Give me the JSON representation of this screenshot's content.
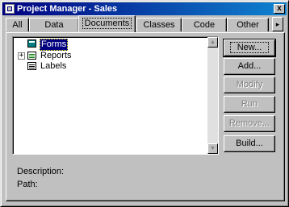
{
  "window": {
    "title": "Project Manager - Sales",
    "close_label": "x"
  },
  "tabs": [
    {
      "label": "All",
      "active": false
    },
    {
      "label": "Data",
      "active": false
    },
    {
      "label": "Documents",
      "active": true
    },
    {
      "label": "Classes",
      "active": false
    },
    {
      "label": "Code",
      "active": false
    },
    {
      "label": "Other",
      "active": false
    }
  ],
  "tab_scroll_label": "▸",
  "tree": {
    "items": [
      {
        "label": "Forms",
        "icon": "form-icon",
        "selected": true,
        "expander": ""
      },
      {
        "label": "Reports",
        "icon": "report-icon",
        "selected": false,
        "expander": "+"
      },
      {
        "label": "Labels",
        "icon": "label-icon",
        "selected": false,
        "expander": ""
      }
    ]
  },
  "scrollbar": {
    "up": "▲",
    "down": "▼"
  },
  "buttons": {
    "new": "New...",
    "add": "Add...",
    "modify": "Modify",
    "run": "Run",
    "remove": "Remove...",
    "build": "Build..."
  },
  "footer": {
    "description_label": "Description:",
    "path_label": "Path:"
  }
}
